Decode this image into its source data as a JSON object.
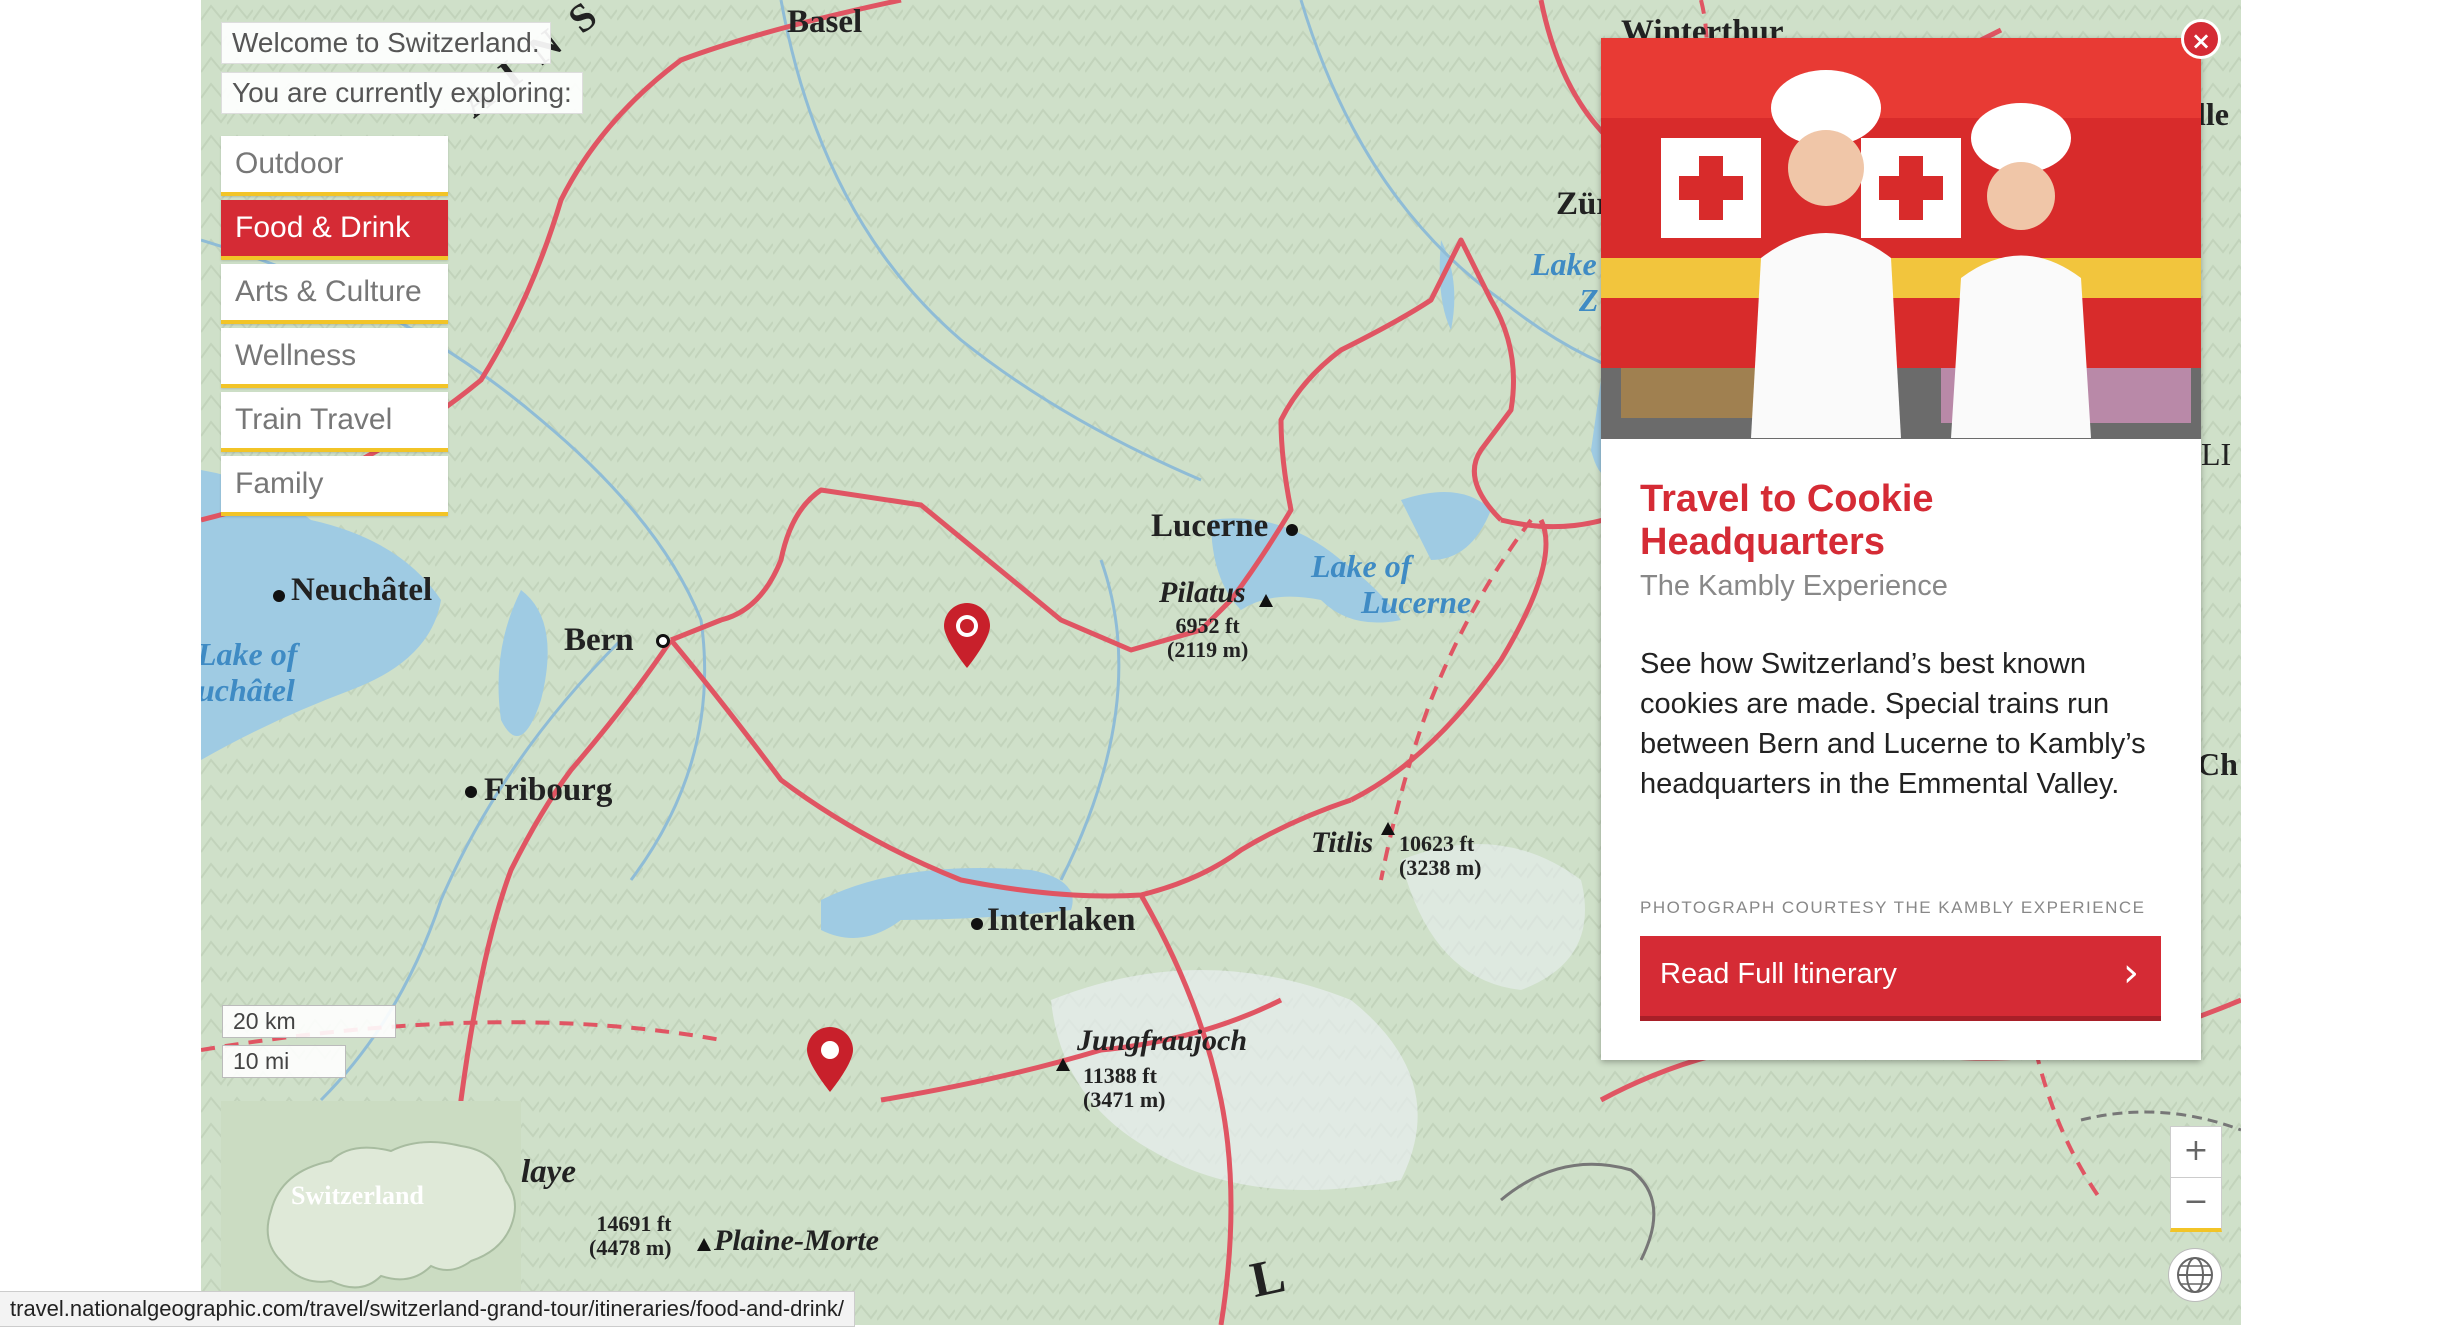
{
  "header": {
    "welcome": "Welcome to Switzerland.",
    "exploring": "You are currently exploring:"
  },
  "categories": [
    {
      "label": "Outdoor",
      "active": false
    },
    {
      "label": "Food & Drink",
      "active": true
    },
    {
      "label": "Arts & Culture",
      "active": false
    },
    {
      "label": "Wellness",
      "active": false
    },
    {
      "label": "Train Travel",
      "active": false
    },
    {
      "label": "Family",
      "active": false
    }
  ],
  "map": {
    "places": {
      "basel": "Basel",
      "zurich": "Zürich",
      "winterthur": "Winterthur",
      "lucerne": "Lucerne",
      "bern": "Bern",
      "neuchatel": "Neuchâtel",
      "fribourg": "Fribourg",
      "interlaken": "Interlaken"
    },
    "lakes": {
      "lucerne": [
        "Lake of",
        "Lucerne"
      ],
      "neuchatel": [
        "Lake of",
        "uchâtel"
      ],
      "zurich": [
        "Lake",
        "Z"
      ]
    },
    "peaks": {
      "pilatus": {
        "name": "Pilatus",
        "ft": "6952 ft",
        "m": "(2119 m)"
      },
      "titlis": {
        "name": "Titlis",
        "ft": "10623 ft",
        "m": "(3238 m)"
      },
      "jungfraujoch": {
        "name": "Jungfraujoch",
        "ft": "11388 ft",
        "m": "(3471 m)"
      },
      "plainemorte": {
        "name": "Plaine-Morte",
        "ft": "14691 ft",
        "m": "(4478 m)"
      }
    },
    "edge_labels": {
      "alps": "A  I  N  S",
      "aye": "laye",
      "right1": "lle",
      "right2": "LI",
      "right3": "Ch",
      "bottom": "L"
    },
    "scale": {
      "km": "20 km",
      "mi": "10 mi"
    },
    "minimap_label": "Switzerland",
    "zoom_in": "+",
    "zoom_out": "−"
  },
  "panel": {
    "title": "Travel to Cookie Headquarters",
    "subtitle": "The Kambly Experience",
    "body": "See how Switzerland’s best known cookies are made. Special trains run between Bern and Lucerne to Kambly’s headquarters in the Emmental Valley.",
    "credit": "PHOTOGRAPH COURTESY THE KAMBLY EXPERIENCE",
    "button": "Read Full Itinerary",
    "close": "×"
  },
  "status_url": "travel.nationalgeographic.com/travel/switzerland-grand-tour/itineraries/food-and-drink/",
  "colors": {
    "accent": "#d52b35",
    "underline": "#f2c427",
    "route": "#e05563",
    "water": "#9fcbe3"
  }
}
